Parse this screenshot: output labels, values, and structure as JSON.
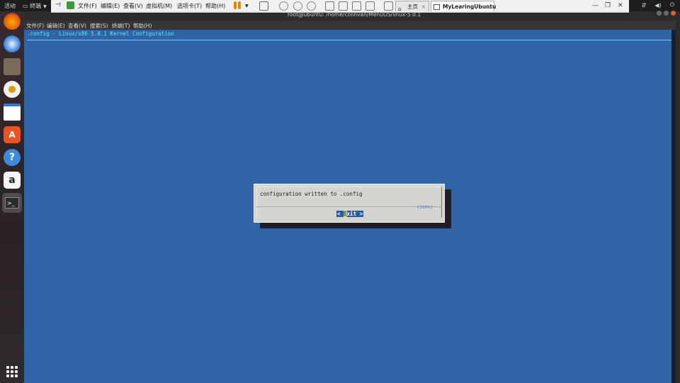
{
  "topbar": {
    "activities": "活动",
    "app_name": "终端",
    "tray_icons": [
      "network-icon",
      "volume-icon",
      "power-icon"
    ]
  },
  "vmware": {
    "menu": [
      "文件(F)",
      "编辑(E)",
      "查看(V)",
      "虚拟机(M)",
      "选项卡(T)",
      "帮助(H)"
    ],
    "tabs": [
      {
        "label": "主页",
        "icon": "home-icon"
      },
      {
        "label": "MyLearingUbuntu",
        "icon": "vm-icon",
        "active": true
      }
    ]
  },
  "terminal": {
    "title": "root@ubuntu: /home/colinvan/MenuOS/linux-5.0.1",
    "menu": [
      "文件(F)",
      "编辑(E)",
      "查看(V)",
      "搜索(S)",
      "终端(T)",
      "帮助(H)"
    ]
  },
  "menuconfig": {
    "header": ".config - Linux/x86 5.0.1 Kernel Configuration",
    "dialog_message": "configuration written to .config",
    "progress": "(100%)",
    "exit_prefix": "< ",
    "exit_hotkey": "E",
    "exit_rest": "xit >"
  },
  "colors": {
    "background": "#3064a6",
    "header_text": "#5ee6ff",
    "dialog_bg": "#d4d4d0",
    "button_bg": "#2a5ca0",
    "hotkey": "#e6d200"
  }
}
